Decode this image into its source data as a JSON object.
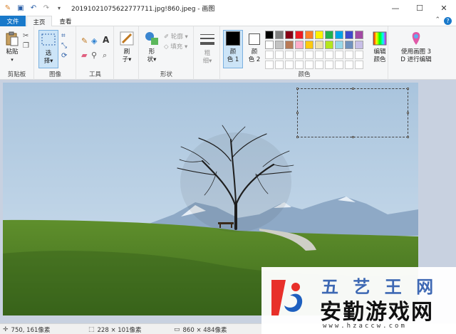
{
  "window": {
    "title": "20191021075622777711.jpg!860.jpeg - 画图",
    "controls": {
      "minimize": "—",
      "maximize": "☐",
      "close": "✕"
    }
  },
  "tabs": {
    "file": "文件",
    "home": "主页",
    "view": "查看",
    "help": "?"
  },
  "ribbon": {
    "clipboard": {
      "paste": "粘贴",
      "group": "剪贴板"
    },
    "image": {
      "select": "选",
      "select2": "择",
      "group": "图像"
    },
    "tools": {
      "group": "工具"
    },
    "brushes": {
      "label1": "刷",
      "label2": "子"
    },
    "shapes": {
      "label1": "形",
      "label2": "状",
      "outline": "轮廓",
      "fill": "填充",
      "group": "形状"
    },
    "size": {
      "label1": "粗",
      "label2": "细"
    },
    "colors": {
      "color1_a": "颜",
      "color1_b": "色 1",
      "color2_a": "颜",
      "color2_b": "色 2",
      "edit_a": "编辑",
      "edit_b": "颜色",
      "paint3d_a": "使用画图 3",
      "paint3d_b": "D 进行编辑",
      "group": "颜色",
      "color1_value": "#000000",
      "color2_value": "#ffffff",
      "palette_row1": [
        "#000000",
        "#7f7f7f",
        "#880015",
        "#ed1c24",
        "#ff7f27",
        "#fff200",
        "#22b14c",
        "#00a2e8",
        "#3f48cc",
        "#a349a4"
      ],
      "palette_row2": [
        "#ffffff",
        "#c3c3c3",
        "#b97a57",
        "#ffaec9",
        "#ffc90e",
        "#efe4b0",
        "#b5e61d",
        "#99d9ea",
        "#7092be",
        "#c8bfe7"
      ]
    }
  },
  "status": {
    "cursor": "750, 161像素",
    "selection": "228 × 101像素",
    "image_size": "860 × 484像素"
  },
  "watermark": {
    "top": "五 艺 王 网",
    "main": "安勤游戏网",
    "url": "www.hzaccw.com"
  }
}
